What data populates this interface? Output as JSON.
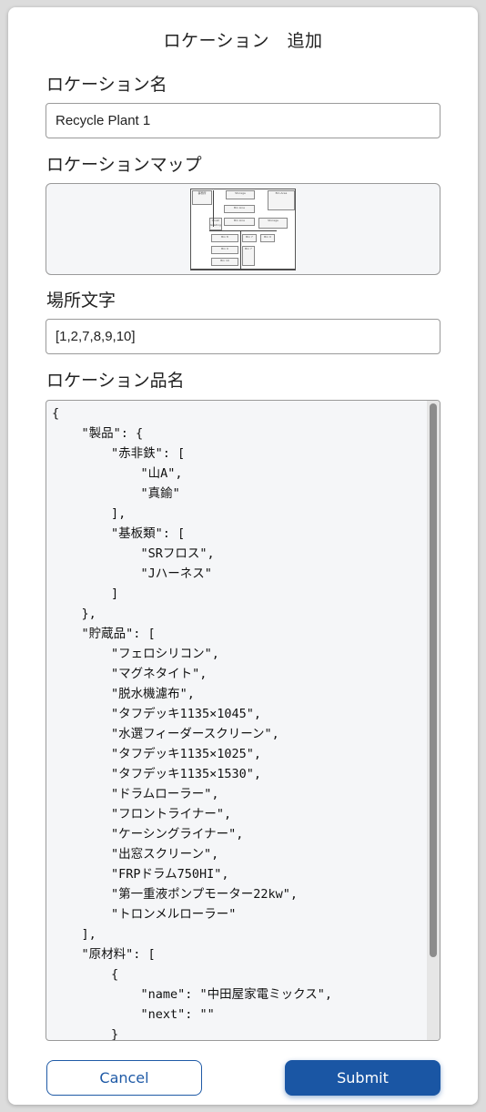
{
  "dialog": {
    "title": "ロケーション　追加"
  },
  "fields": {
    "location_name": {
      "label": "ロケーション名",
      "value": "Recycle Plant 1"
    },
    "location_map": {
      "label": "ロケーションマップ",
      "rooms": [
        "事務所",
        "Storage",
        "Bin Area",
        "Bin Line",
        "Crush Grading",
        "Bin Line",
        "Storage",
        "Bin 8",
        "Bin 7",
        "Bin 9",
        "Bin 9",
        "Bin 10",
        "Bin 7"
      ]
    },
    "place_chars": {
      "label": "場所文字",
      "value": "[1,2,7,8,9,10]"
    },
    "location_items": {
      "label": "ロケーション品名",
      "json_text": "{\n    \"製品\": {\n        \"赤非鉄\": [\n            \"山A\",\n            \"真鍮\"\n        ],\n        \"基板類\": [\n            \"SRフロス\",\n            \"Jハーネス\"\n        ]\n    },\n    \"貯蔵品\": [\n        \"フェロシリコン\",\n        \"マグネタイト\",\n        \"脱水機濾布\",\n        \"タフデッキ1135×1045\",\n        \"水選フィーダースクリーン\",\n        \"タフデッキ1135×1025\",\n        \"タフデッキ1135×1530\",\n        \"ドラムローラー\",\n        \"フロントライナー\",\n        \"ケーシングライナー\",\n        \"出窓スクリーン\",\n        \"FRPドラム750HI\",\n        \"第一重液ポンプモーター22kw\",\n        \"トロンメルローラー\"\n    ],\n    \"原材料\": [\n        {\n            \"name\": \"中田屋家電ミックス\",\n            \"next\": \"\"\n        }\n    ],\n    \"仕掛品\": ["
    }
  },
  "buttons": {
    "cancel": "Cancel",
    "submit": "Submit"
  },
  "colors": {
    "accent": "#1a56a4",
    "field_bg": "#f5f6f8"
  }
}
